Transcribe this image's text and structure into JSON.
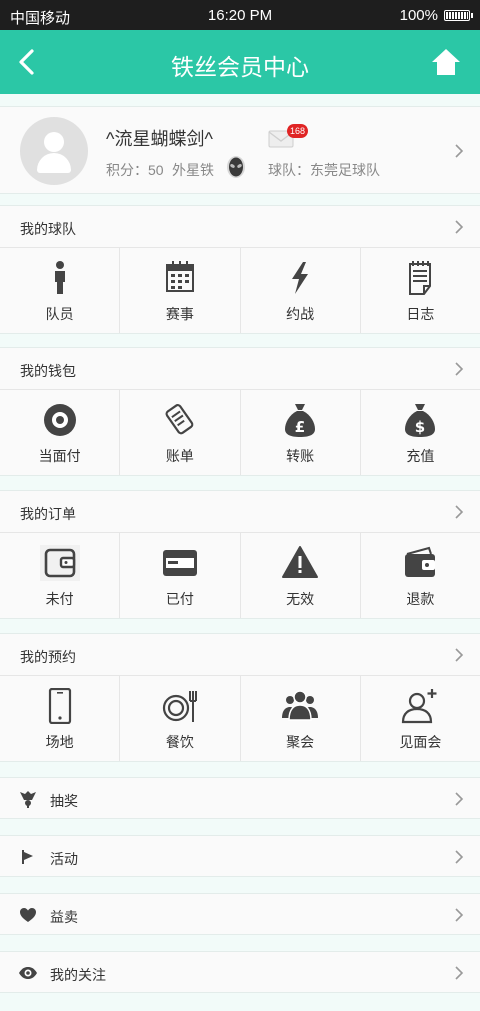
{
  "status_bar": {
    "carrier": "中国移动",
    "time": "16:20 PM",
    "battery": "100%"
  },
  "header": {
    "title": "铁丝会员中心"
  },
  "profile": {
    "username": "^流星蝴蝶剑^",
    "points": "积分：50",
    "level": "外星铁",
    "message_count": "168",
    "team": "球队：东莞足球队"
  },
  "sections": [
    {
      "title": "我的球队",
      "items": [
        {
          "label": "队员",
          "icon": "person-icon"
        },
        {
          "label": "赛事",
          "icon": "calendar-icon"
        },
        {
          "label": "约战",
          "icon": "lightning-icon"
        },
        {
          "label": "日志",
          "icon": "notepad-icon"
        }
      ]
    },
    {
      "title": "我的钱包",
      "items": [
        {
          "label": "当面付",
          "icon": "disc-icon"
        },
        {
          "label": "账单",
          "icon": "receipt-icon"
        },
        {
          "label": "转账",
          "icon": "pound-bag-icon"
        },
        {
          "label": "充值",
          "icon": "dollar-bag-icon"
        }
      ]
    },
    {
      "title": "我的订单",
      "items": [
        {
          "label": "未付",
          "icon": "wallet-icon"
        },
        {
          "label": "已付",
          "icon": "card-icon"
        },
        {
          "label": "无效",
          "icon": "warning-icon"
        },
        {
          "label": "退款",
          "icon": "purse-icon"
        }
      ]
    },
    {
      "title": "我的预约",
      "items": [
        {
          "label": "场地",
          "icon": "phone-icon"
        },
        {
          "label": "餐饮",
          "icon": "dining-icon"
        },
        {
          "label": "聚会",
          "icon": "group-icon"
        },
        {
          "label": "见面会",
          "icon": "add-user-icon"
        }
      ]
    }
  ],
  "list": [
    {
      "label": "抽奖",
      "icon": "prize-icon"
    },
    {
      "label": "活动",
      "icon": "flag-icon"
    },
    {
      "label": "益卖",
      "icon": "heart-icon"
    },
    {
      "label": "我的关注",
      "icon": "eye-icon"
    }
  ],
  "colors": {
    "accent": "#2bc7a6",
    "icon": "#444444",
    "badge": "#e02424"
  }
}
